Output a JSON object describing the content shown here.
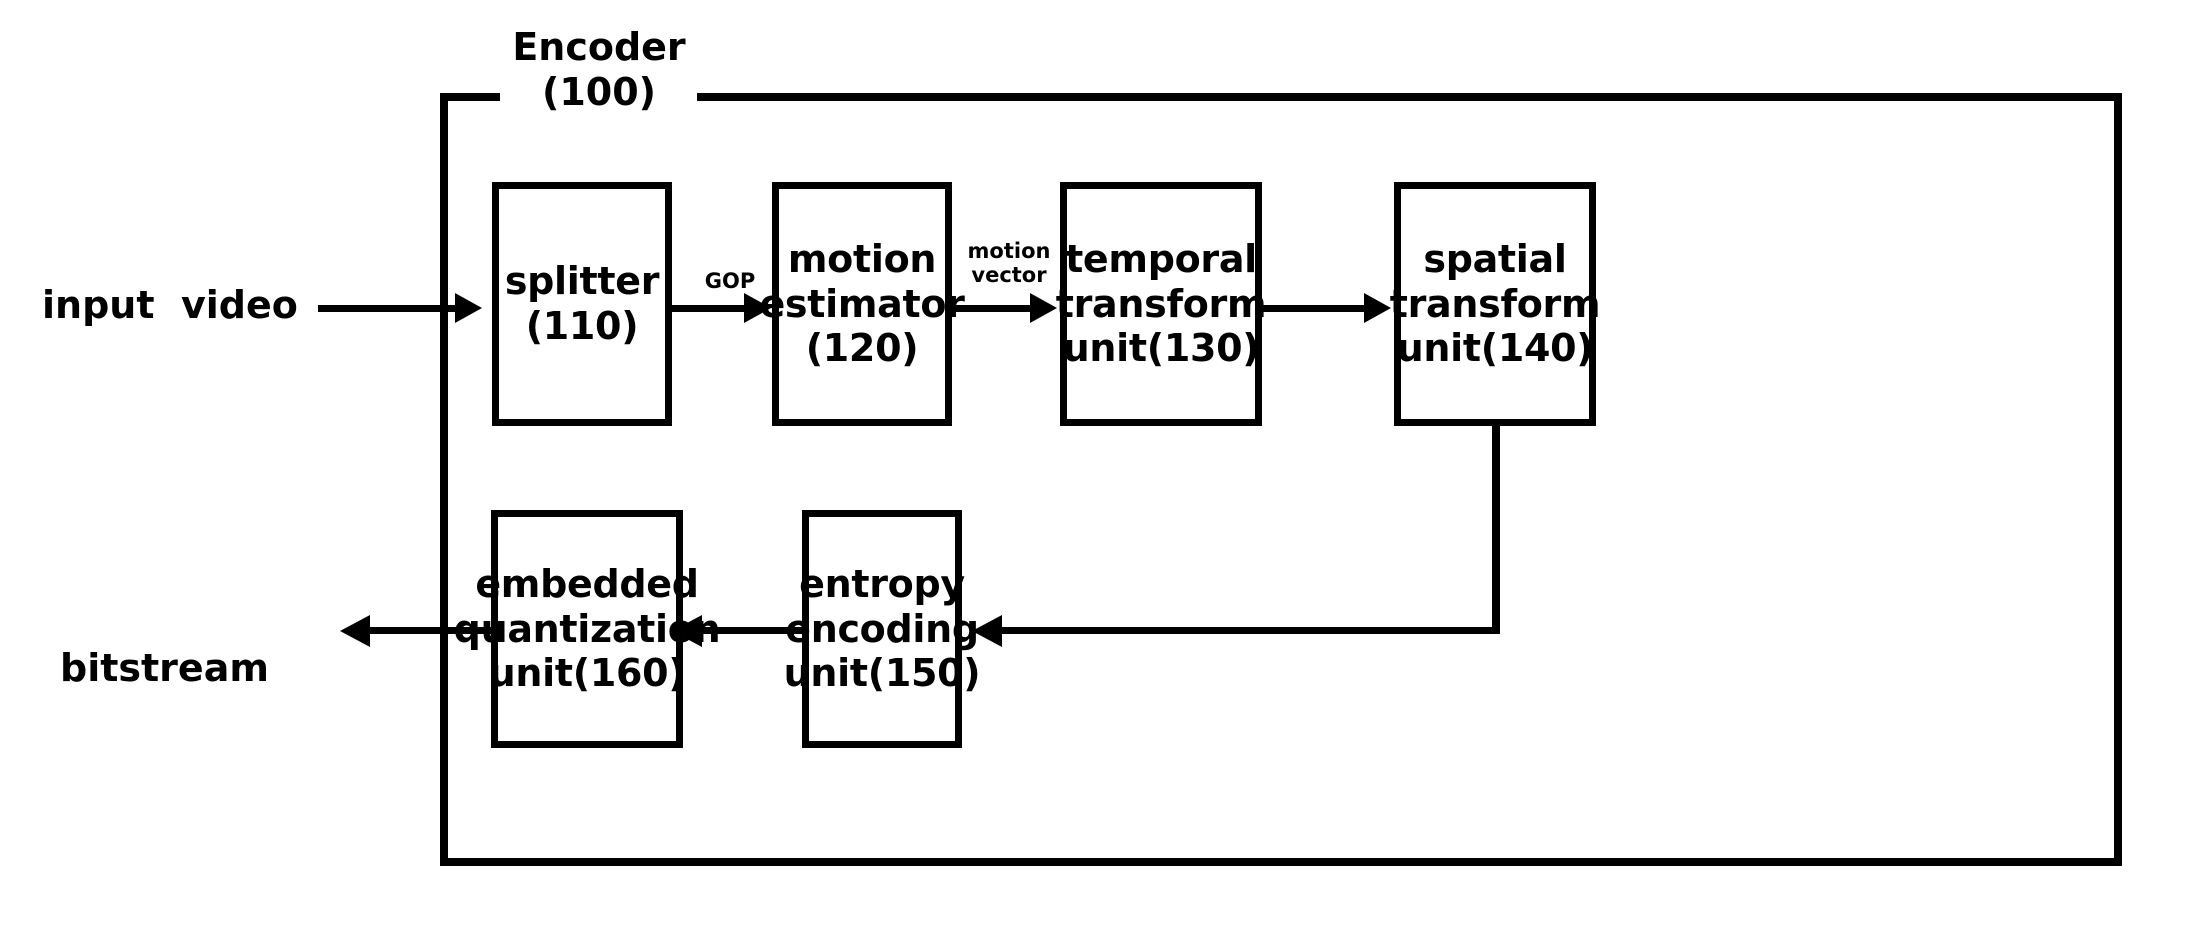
{
  "figure": {
    "type": "block-diagram",
    "subject": "video encoder pipeline",
    "enclosure": {
      "title": "Encoder\n(100)",
      "name": "Encoder",
      "reference_numeral": "100"
    },
    "io_labels": {
      "input": "input  video",
      "output": "bitstream"
    },
    "edge_labels": {
      "splitter_to_motion_estimator": "GOP",
      "motion_estimator_to_temporal": "motion\nvector"
    },
    "blocks": [
      {
        "id": "splitter",
        "label": "splitter\n(110)",
        "name": "splitter",
        "reference_numeral": "110"
      },
      {
        "id": "motion-estimator",
        "label": "motion\nestimator\n(120)",
        "name": "motion estimator",
        "reference_numeral": "120"
      },
      {
        "id": "temporal-transform-unit",
        "label": "temporal\ntransform\nunit(130)",
        "name": "temporal transform unit",
        "reference_numeral": "130"
      },
      {
        "id": "spatial-transform-unit",
        "label": "spatial\ntransform\nunit(140)",
        "name": "spatial transform unit",
        "reference_numeral": "140"
      },
      {
        "id": "entropy-encoding-unit",
        "label": "entropy\nencoding\nunit(150)",
        "name": "entropy encoding unit",
        "reference_numeral": "150"
      },
      {
        "id": "embedded-quantization-unit",
        "label": "embedded\nquantization\nunit(160)",
        "name": "embedded quantization unit",
        "reference_numeral": "160"
      }
    ],
    "colors": {
      "ink": "#000000",
      "paper": "#ffffff"
    }
  }
}
